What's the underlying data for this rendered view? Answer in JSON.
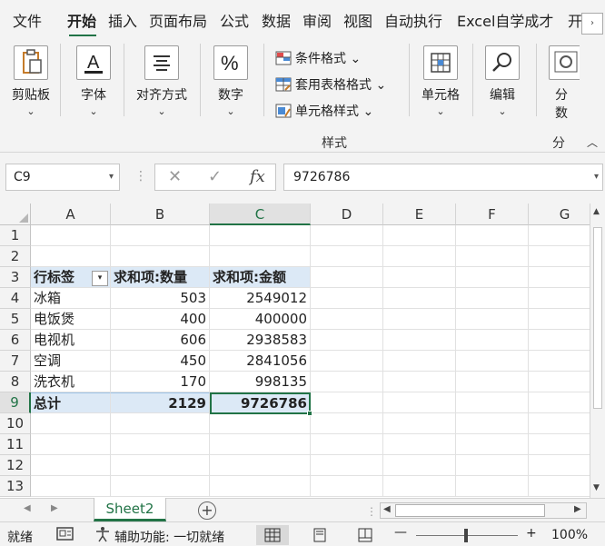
{
  "tabs": [
    "文件",
    "开始",
    "插入",
    "页面布局",
    "公式",
    "数据",
    "审阅",
    "视图",
    "自动执行",
    "Excel自学成才",
    "开"
  ],
  "tab_scroll": "›",
  "ribbon": {
    "clipboard": "剪贴板",
    "font": "字体",
    "align": "对齐方式",
    "number": "数字",
    "cond_format": "条件格式",
    "table_format": "套用表格格式",
    "cell_style": "单元格样式",
    "styles_group": "样式",
    "cells": "单元格",
    "edit": "编辑",
    "analysis_top": "分",
    "analysis_bottom": "数",
    "analysis_group": "分",
    "chev": "⌄",
    "collapse": "︿"
  },
  "formula_bar": {
    "name_box": "C9",
    "value": "9726786",
    "fx": "fx",
    "cancel": "✕",
    "confirm": "✓",
    "dots": "⋮"
  },
  "grid": {
    "columns": [
      "A",
      "B",
      "C",
      "D",
      "E",
      "F",
      "G"
    ],
    "rows": [
      "1",
      "2",
      "3",
      "4",
      "5",
      "6",
      "7",
      "8",
      "9",
      "10",
      "11",
      "12",
      "13"
    ],
    "header": {
      "a": "行标签",
      "b": "求和项:数量",
      "c": "求和项:金额",
      "filter": "▾"
    },
    "data": [
      {
        "label": "冰箱",
        "qty": "503",
        "amount": "2549012"
      },
      {
        "label": "电饭煲",
        "qty": "400",
        "amount": "400000"
      },
      {
        "label": "电视机",
        "qty": "606",
        "amount": "2938583"
      },
      {
        "label": "空调",
        "qty": "450",
        "amount": "2841056"
      },
      {
        "label": "洗衣机",
        "qty": "170",
        "amount": "998135"
      }
    ],
    "total": {
      "label": "总计",
      "qty": "2129",
      "amount": "9726786"
    }
  },
  "sheet": {
    "name": "Sheet2",
    "add": "+",
    "prev": "◀",
    "next": "▶"
  },
  "status": {
    "ready": "就绪",
    "accessibility": "辅助功能: 一切就绪",
    "zoom": "100%",
    "minus": "—",
    "plus": "+"
  },
  "colors": {
    "accent": "#217346",
    "pivot_fill": "#dce9f6"
  }
}
